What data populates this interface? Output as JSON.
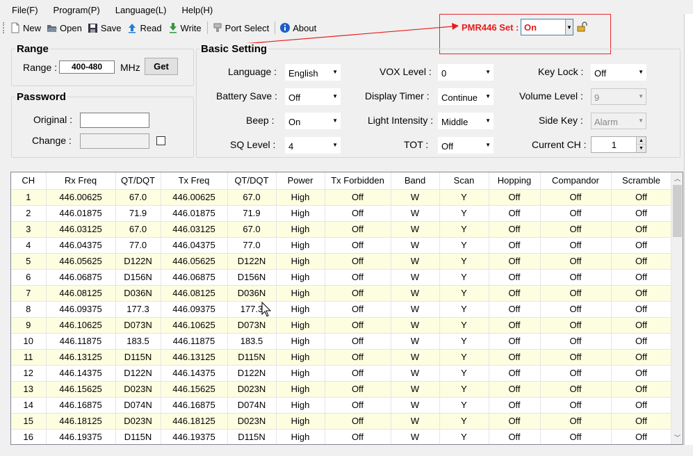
{
  "menu": [
    "File(F)",
    "Program(P)",
    "Language(L)",
    "Help(H)"
  ],
  "toolbar": {
    "new": "New",
    "open": "Open",
    "save": "Save",
    "read": "Read",
    "write": "Write",
    "port_select": "Port Select",
    "about": "About"
  },
  "pmr446": {
    "label": "PMR446 Set :",
    "value": "On",
    "accent": "#e81b1b"
  },
  "range": {
    "title": "Range",
    "label": "Range :",
    "value": "400-480",
    "unit": "MHz",
    "get_button": "Get"
  },
  "password": {
    "title": "Password",
    "original_label": "Original :",
    "original_value": "",
    "change_label": "Change :",
    "change_value": ""
  },
  "basic": {
    "title": "Basic Setting",
    "language_label": "Language :",
    "language_value": "English",
    "vox_label": "VOX Level :",
    "vox_value": "0",
    "keylock_label": "Key Lock :",
    "keylock_value": "Off",
    "battery_label": "Battery Save :",
    "battery_value": "Off",
    "display_label": "Display Timer :",
    "display_value": "Continue",
    "volume_label": "Volume Level :",
    "volume_value": "9",
    "beep_label": "Beep :",
    "beep_value": "On",
    "light_label": "Light Intensity :",
    "light_value": "Middle",
    "sidekey_label": "Side Key :",
    "sidekey_value": "Alarm",
    "sq_label": "SQ Level :",
    "sq_value": "4",
    "tot_label": "TOT :",
    "tot_value": "Off",
    "currentch_label": "Current CH :",
    "currentch_value": "1"
  },
  "table": {
    "columns": [
      "CH",
      "Rx Freq",
      "QT/DQT",
      "Tx Freq",
      "QT/DQT",
      "Power",
      "Tx Forbidden",
      "Band",
      "Scan",
      "Hopping",
      "Compandor",
      "Scramble"
    ],
    "rows": [
      [
        "1",
        "446.00625",
        "67.0",
        "446.00625",
        "67.0",
        "High",
        "Off",
        "W",
        "Y",
        "Off",
        "Off",
        "Off"
      ],
      [
        "2",
        "446.01875",
        "71.9",
        "446.01875",
        "71.9",
        "High",
        "Off",
        "W",
        "Y",
        "Off",
        "Off",
        "Off"
      ],
      [
        "3",
        "446.03125",
        "67.0",
        "446.03125",
        "67.0",
        "High",
        "Off",
        "W",
        "Y",
        "Off",
        "Off",
        "Off"
      ],
      [
        "4",
        "446.04375",
        "77.0",
        "446.04375",
        "77.0",
        "High",
        "Off",
        "W",
        "Y",
        "Off",
        "Off",
        "Off"
      ],
      [
        "5",
        "446.05625",
        "D122N",
        "446.05625",
        "D122N",
        "High",
        "Off",
        "W",
        "Y",
        "Off",
        "Off",
        "Off"
      ],
      [
        "6",
        "446.06875",
        "D156N",
        "446.06875",
        "D156N",
        "High",
        "Off",
        "W",
        "Y",
        "Off",
        "Off",
        "Off"
      ],
      [
        "7",
        "446.08125",
        "D036N",
        "446.08125",
        "D036N",
        "High",
        "Off",
        "W",
        "Y",
        "Off",
        "Off",
        "Off"
      ],
      [
        "8",
        "446.09375",
        "177.3",
        "446.09375",
        "177.3",
        "High",
        "Off",
        "W",
        "Y",
        "Off",
        "Off",
        "Off"
      ],
      [
        "9",
        "446.10625",
        "D073N",
        "446.10625",
        "D073N",
        "High",
        "Off",
        "W",
        "Y",
        "Off",
        "Off",
        "Off"
      ],
      [
        "10",
        "446.11875",
        "183.5",
        "446.11875",
        "183.5",
        "High",
        "Off",
        "W",
        "Y",
        "Off",
        "Off",
        "Off"
      ],
      [
        "11",
        "446.13125",
        "D115N",
        "446.13125",
        "D115N",
        "High",
        "Off",
        "W",
        "Y",
        "Off",
        "Off",
        "Off"
      ],
      [
        "12",
        "446.14375",
        "D122N",
        "446.14375",
        "D122N",
        "High",
        "Off",
        "W",
        "Y",
        "Off",
        "Off",
        "Off"
      ],
      [
        "13",
        "446.15625",
        "D023N",
        "446.15625",
        "D023N",
        "High",
        "Off",
        "W",
        "Y",
        "Off",
        "Off",
        "Off"
      ],
      [
        "14",
        "446.16875",
        "D074N",
        "446.16875",
        "D074N",
        "High",
        "Off",
        "W",
        "Y",
        "Off",
        "Off",
        "Off"
      ],
      [
        "15",
        "446.18125",
        "D023N",
        "446.18125",
        "D023N",
        "High",
        "Off",
        "W",
        "Y",
        "Off",
        "Off",
        "Off"
      ],
      [
        "16",
        "446.19375",
        "D115N",
        "446.19375",
        "D115N",
        "High",
        "Off",
        "W",
        "Y",
        "Off",
        "Off",
        "Off"
      ]
    ]
  }
}
